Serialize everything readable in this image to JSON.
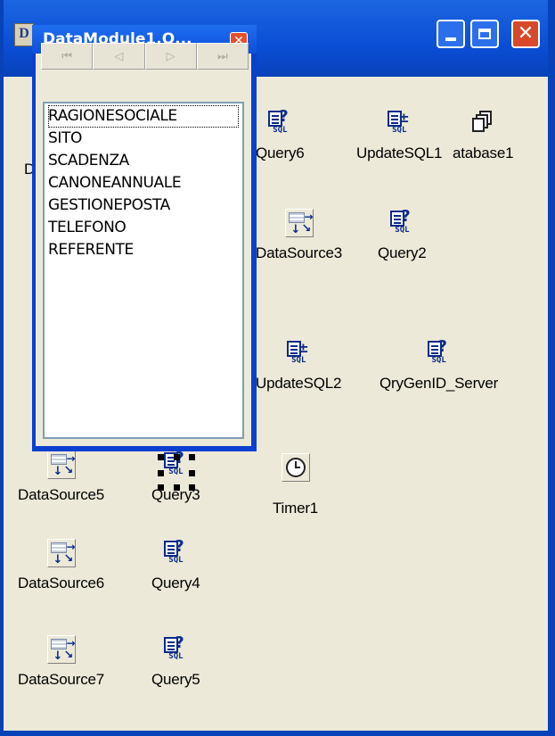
{
  "outer_window": {
    "icon_letter": "D",
    "caption_buttons": {
      "minimize": "minimize",
      "maximize": "maximize",
      "close": "close"
    }
  },
  "field_editor": {
    "title": "DataModule1.Q...",
    "nav_buttons": [
      "⏮",
      "◁",
      "▷",
      "⏭"
    ],
    "fields": [
      "RAGIONESOCIALE",
      "SITO",
      "SCADENZA",
      "CANONEANNUALE",
      "GESTIONEPOSTA",
      "TELEFONO",
      "REFERENTE"
    ],
    "focused_field": "RAGIONESOCIALE"
  },
  "components": {
    "database1_partial_label": "D",
    "query6": "Query6",
    "updatesql1": "UpdateSQL1",
    "database1": "atabase1",
    "datasource3": "DataSource3",
    "query2": "Query2",
    "updatesql2": "UpdateSQL2",
    "qrygenid_server": "QryGenID_Server",
    "datasource5": "DataSource5",
    "query3": "Query3",
    "timer1": "Timer1",
    "datasource6": "DataSource6",
    "query4": "Query4",
    "datasource7": "DataSource7",
    "query5": "Query5"
  },
  "colors": {
    "xp_title_blue": "#0a4ed6",
    "window_face": "#ece9d8",
    "close_red": "#d8482a",
    "icon_blue": "#0a2a8a"
  }
}
